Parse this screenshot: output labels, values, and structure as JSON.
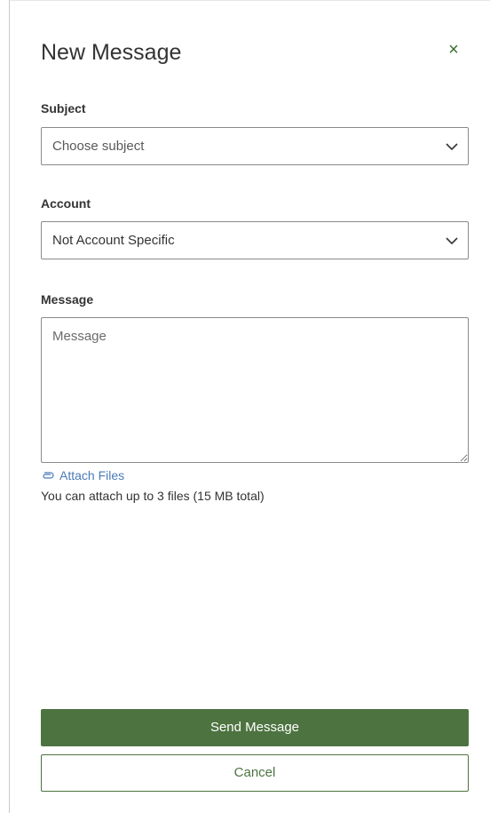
{
  "dialog": {
    "title": "New Message",
    "close_glyph": "×"
  },
  "subject": {
    "label": "Subject",
    "value": "Choose subject"
  },
  "account": {
    "label": "Account",
    "value": "Not Account Specific"
  },
  "message": {
    "label": "Message",
    "placeholder": "Message",
    "value": ""
  },
  "attachments": {
    "link_label": "Attach Files",
    "note": "You can attach up to 3 files (15 MB total)"
  },
  "actions": {
    "send_label": "Send Message",
    "cancel_label": "Cancel"
  },
  "colors": {
    "primary": "#4d7340",
    "link": "#4a7bb7"
  },
  "icons": {
    "close": "close-icon",
    "dropdown": "chevron-down-icon",
    "attach": "paperclip-icon"
  }
}
